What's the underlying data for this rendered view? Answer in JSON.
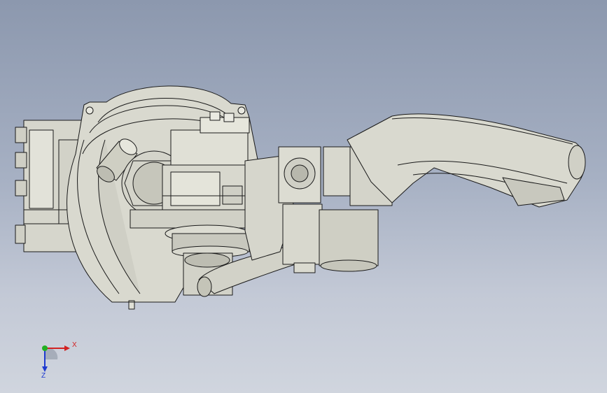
{
  "viewport": {
    "background_top": "#8c98ae",
    "background_bottom": "#d0d5de",
    "model": {
      "subject": "robot-arm-cad-model",
      "shade_color": "#dcdcd2",
      "edge_color": "#1a1a1a"
    }
  },
  "triad": {
    "x_label": "X",
    "z_label": "Z",
    "x_color": "#d22222",
    "y_color": "#22b022",
    "z_color": "#1e3ad0"
  }
}
